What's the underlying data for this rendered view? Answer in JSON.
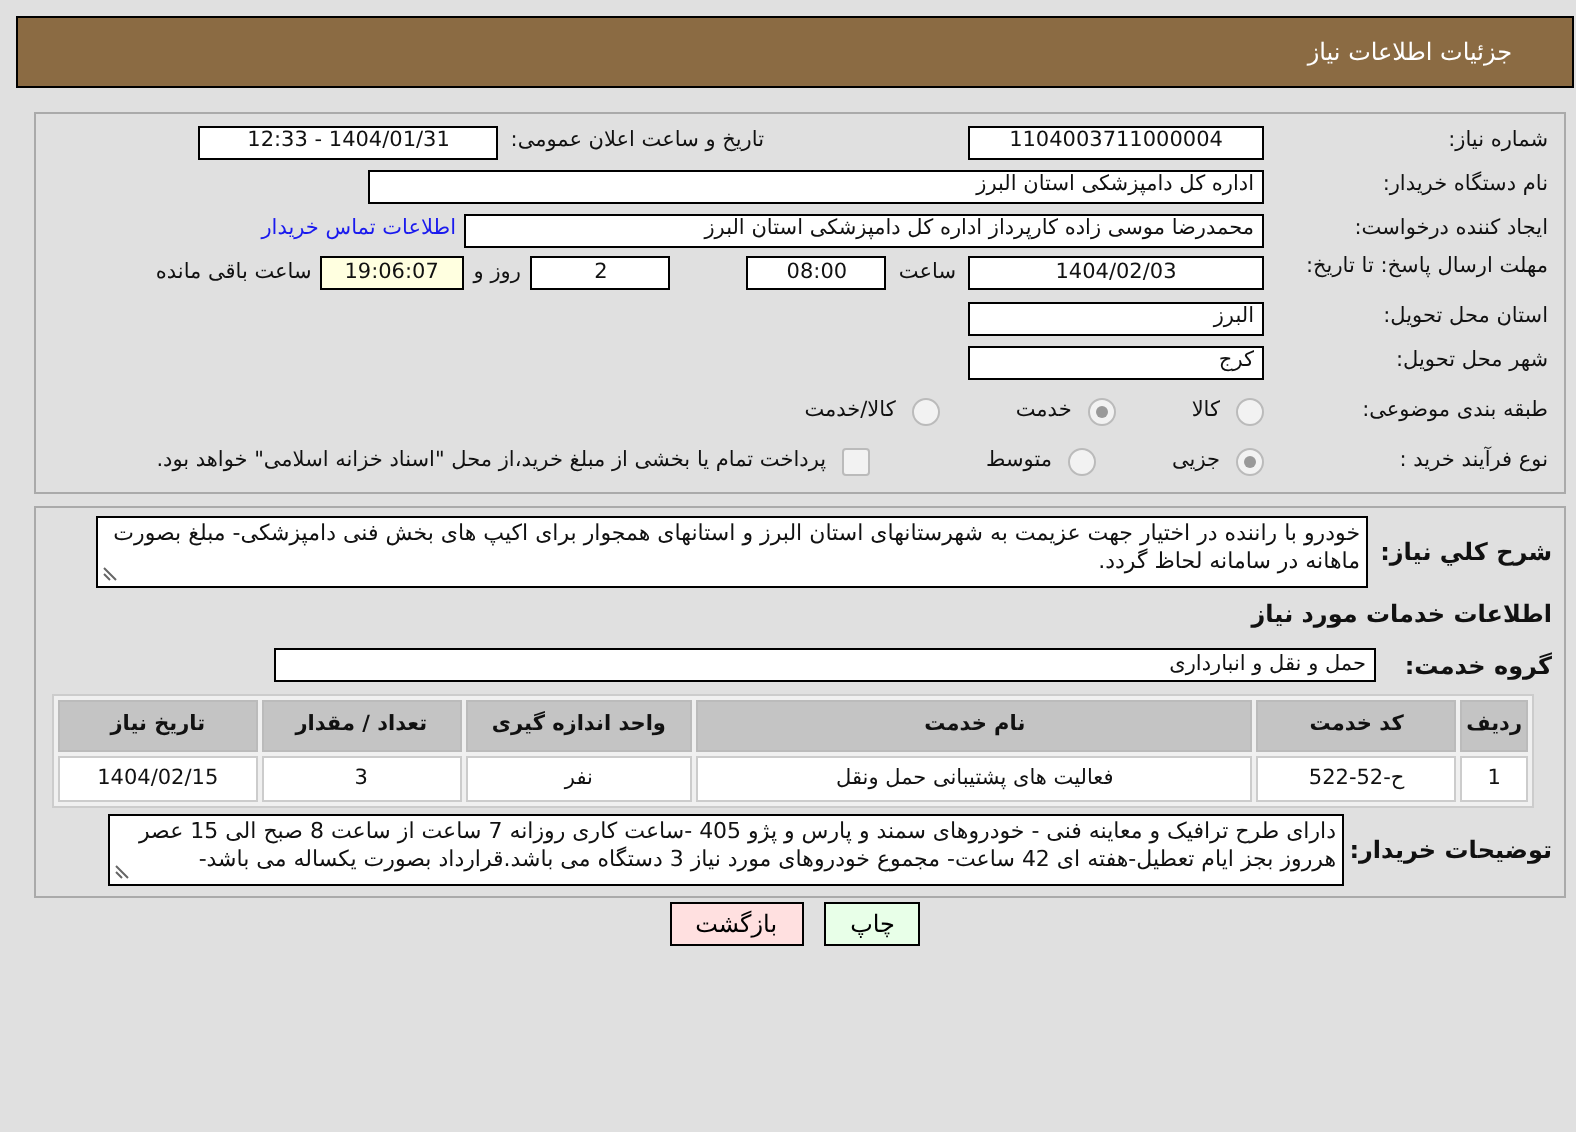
{
  "header": {
    "title": "جزئیات اطلاعات نیاز"
  },
  "need_number": {
    "label": "شماره نیاز:",
    "value": "1104003711000004"
  },
  "announce": {
    "label": "تاریخ و ساعت اعلان عمومی:",
    "value": "1404/01/31 - 12:33"
  },
  "buyer_org": {
    "label": "نام دستگاه خریدار:",
    "value": "اداره کل دامپزشکی استان البرز"
  },
  "requester": {
    "label": "ایجاد کننده درخواست:",
    "value": "محمدرضا موسی زاده کارپرداز اداره کل دامپزشکی استان البرز",
    "link": "اطلاعات تماس خریدار"
  },
  "deadline": {
    "label": "مهلت ارسال پاسخ: تا تاریخ:",
    "date": "1404/02/03",
    "time_label": "ساعت",
    "time": "08:00",
    "days": "2",
    "days_label": "روز و",
    "remaining": "19:06:07",
    "remaining_label": "ساعت باقی مانده"
  },
  "province": {
    "label": "استان محل تحویل:",
    "value": "البرز"
  },
  "city": {
    "label": "شهر محل تحویل:",
    "value": "کرج"
  },
  "category": {
    "label": "طبقه بندی موضوعی:",
    "options": [
      {
        "label": "کالا",
        "selected": false
      },
      {
        "label": "خدمت",
        "selected": true
      },
      {
        "label": "کالا/خدمت",
        "selected": false
      }
    ]
  },
  "process": {
    "label": "نوع فرآیند خرید :",
    "options": [
      {
        "label": "جزیی",
        "selected": true
      },
      {
        "label": "متوسط",
        "selected": false
      }
    ],
    "checkbox": {
      "label": "پرداخت تمام یا بخشی از مبلغ خرید،از محل \"اسناد خزانه اسلامی\" خواهد بود.",
      "checked": false
    }
  },
  "description": {
    "label": "شرح کلي نياز:",
    "value": "خودرو با راننده در اختیار جهت عزیمت به شهرستانهای استان البرز و استانهای همجوار برای اکیپ های بخش فنی دامپزشکی- مبلغ بصورت ماهانه در سامانه لحاظ گردد."
  },
  "services_title": "اطلاعات خدمات مورد نیاز",
  "service_group": {
    "label": "گروه خدمت:",
    "value": "حمل و نقل و انبارداری"
  },
  "table": {
    "columns": [
      "ردیف",
      "کد خدمت",
      "نام خدمت",
      "واحد اندازه گیری",
      "تعداد / مقدار",
      "تاریخ نیاز"
    ],
    "rows": [
      [
        "1",
        "ح-52-522",
        "فعالیت های پشتیبانی حمل ونقل",
        "نفر",
        "3",
        "1404/02/15"
      ]
    ]
  },
  "buyer_notes": {
    "label": "توضیحات خریدار:",
    "value": "دارای طرح ترافیک و معاینه فنی - خودروهای سمند و پارس و پژو 405 -ساعت کاری روزانه 7 ساعت از ساعت 8 صبح الی 15 عصر هرروز بجز ایام تعطیل-هفته ای 42 ساعت- مجموع خودروهای مورد نیاز 3 دستگاه می باشد.قرارداد بصورت یکساله می باشد-"
  },
  "buttons": [
    {
      "label": "چاپ",
      "kind": "print"
    },
    {
      "label": "بازگشت",
      "kind": "back"
    }
  ]
}
